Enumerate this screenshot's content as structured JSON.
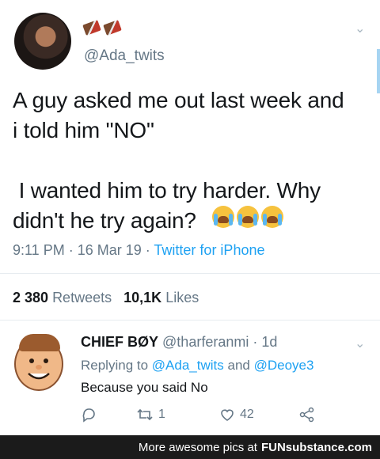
{
  "tweet": {
    "handle": "@Ada_twits",
    "text": "A guy asked me out last week and\ni told him \"NO\"\n\n I wanted him to try harder. Why\ndidn't he try again?",
    "time": "9:11 PM · 16 Mar 19 · ",
    "source": "Twitter for iPhone",
    "retweets_count": "2 380",
    "retweets_label": "Retweets",
    "likes_count": "10,1K",
    "likes_label": "Likes",
    "chevron": "⌄",
    "emoji_icons": [
      "loudly-crying-face-icon",
      "loudly-crying-face-icon",
      "loudly-crying-face-icon"
    ]
  },
  "reply": {
    "name": "CHIEF BØY",
    "handle_time": "@tharferanmi · 1d",
    "replying_prefix": "Replying to",
    "replying_to_1": "@Ada_twits",
    "replying_and": "and",
    "replying_to_2": "@Deoye3",
    "text": "Because you said No",
    "retweet_count": "1",
    "like_count": "42"
  },
  "footer": {
    "text": "More awesome pics at",
    "brand_fun": "FUN",
    "brand_rest": "substance.com"
  },
  "colors": {
    "link": "#1da1f2",
    "muted": "#657786",
    "text": "#14171a"
  }
}
